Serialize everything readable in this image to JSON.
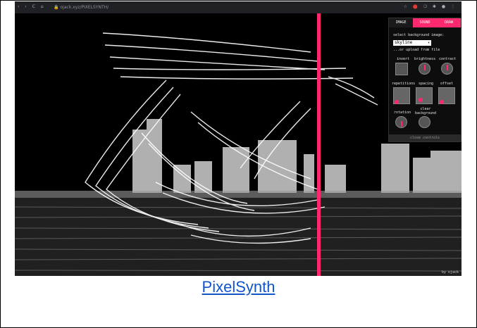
{
  "browser": {
    "nav_icons": "‹ › C ⌂",
    "url": "🔒 ojack.xyz/PIXELSYNTH/",
    "toolbar_icons": [
      "☆",
      "⬤",
      "❍",
      "✱",
      "●",
      "⋮"
    ]
  },
  "panel": {
    "tabs": [
      {
        "label": "IMAGE",
        "state": "active"
      },
      {
        "label": "SOUND",
        "state": "inactive"
      },
      {
        "label": "DRAW",
        "state": "inactive"
      }
    ],
    "select_label": "select background image:",
    "select_value": "skyline",
    "upload_link": "...or upload from file",
    "controls_row1": [
      "invert",
      "brightness",
      "contrast"
    ],
    "controls_row2": [
      "repetitions",
      "spacing",
      "offset"
    ],
    "controls_row3": [
      "rotation",
      "clear background"
    ],
    "close_button": "close controls"
  },
  "credit": "by ojack",
  "caption": {
    "text": "PixelSynth"
  },
  "colors": {
    "accent": "#ff2a6d",
    "background": "#000000",
    "caption_link": "#1155cc"
  }
}
